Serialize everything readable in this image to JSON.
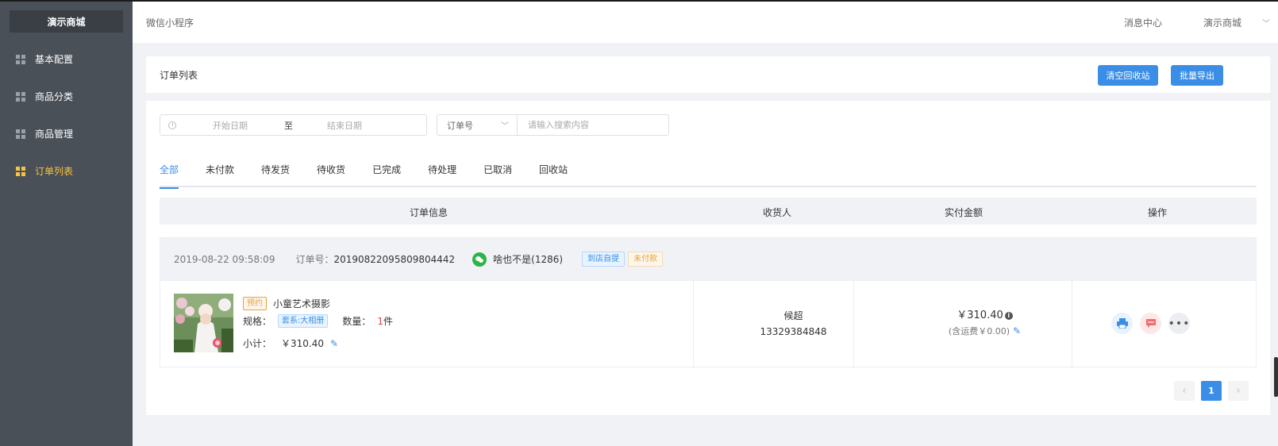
{
  "sidebar": {
    "brand": "演示商城",
    "items": [
      {
        "label": "基本配置",
        "icon": "grid-icon",
        "active": false
      },
      {
        "label": "商品分类",
        "icon": "grid-icon",
        "active": false
      },
      {
        "label": "商品管理",
        "icon": "grid-icon",
        "active": false
      },
      {
        "label": "订单列表",
        "icon": "grid-icon",
        "active": true
      }
    ]
  },
  "header": {
    "breadcrumb": "微信小程序",
    "message_center": "消息中心",
    "store_name": "演示商城"
  },
  "toolbar": {
    "title": "订单列表",
    "clear_recycle_label": "清空回收站",
    "batch_export_label": "批量导出"
  },
  "filters": {
    "start_date_placeholder": "开始日期",
    "range_separator": "至",
    "end_date_placeholder": "结束日期",
    "search_field_selected": "订单号",
    "search_placeholder": "请输入搜索内容"
  },
  "tabs": [
    {
      "label": "全部",
      "active": true
    },
    {
      "label": "未付款",
      "active": false
    },
    {
      "label": "待发货",
      "active": false
    },
    {
      "label": "待收货",
      "active": false
    },
    {
      "label": "已完成",
      "active": false
    },
    {
      "label": "待处理",
      "active": false
    },
    {
      "label": "已取消",
      "active": false
    },
    {
      "label": "回收站",
      "active": false
    }
  ],
  "table": {
    "headers": {
      "order_info": "订单信息",
      "receiver": "收货人",
      "paid_amount": "实付金额",
      "actions": "操作"
    }
  },
  "order": {
    "time": "2019-08-22 09:58:09",
    "order_no_label": "订单号：",
    "order_no": "20190822095809804442",
    "buyer": "啥也不是(1286)",
    "delivery_tag": "到店自提",
    "pay_status_tag": "未付款",
    "product": {
      "pre_tag": "预约",
      "name": "小童艺术摄影",
      "spec_label": "规格：",
      "spec_value": "套系:大相册",
      "qty_label": "数量：",
      "qty_value": "1",
      "qty_unit": "件",
      "subtotal_label": "小计：",
      "subtotal_value": "￥310.40"
    },
    "receiver_name": "候超",
    "receiver_phone": "13329384848",
    "amount": "￥310.40",
    "shipping_note": "(含运费￥0.00)"
  },
  "pagination": {
    "current_page": "1",
    "prev_label": "‹",
    "next_label": "›"
  },
  "colors": {
    "sidebar_bg": "#4a5058",
    "accent": "#3a8ee6",
    "active_menu": "#f6c342",
    "warning": "#e6a23c"
  }
}
